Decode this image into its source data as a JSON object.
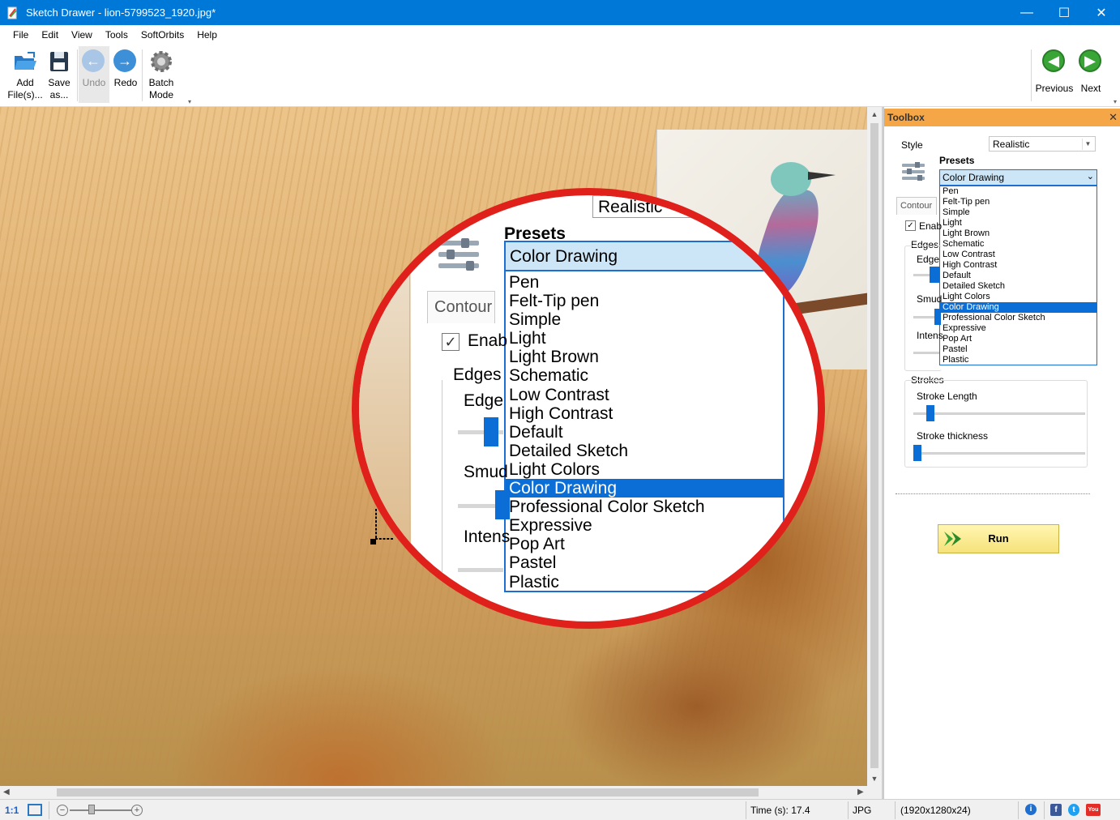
{
  "window": {
    "title": "Sketch Drawer - lion-5799523_1920.jpg*",
    "minimize": "—",
    "maximize": "☐",
    "close": "✕"
  },
  "menu": [
    "File",
    "Edit",
    "View",
    "Tools",
    "SoftOrbits",
    "Help"
  ],
  "toolbar": {
    "add_files": "Add\nFile(s)...",
    "save_as": "Save\nas...",
    "undo": "Undo",
    "redo": "Redo",
    "batch_mode": "Batch\nMode",
    "previous": "Previous",
    "next": "Next"
  },
  "toolbox": {
    "title": "Toolbox",
    "close": "✕",
    "style_label": "Style",
    "style_value": "Realistic",
    "presets_label": "Presets",
    "presets_value": "Color Drawing",
    "presets_options": [
      "Pen",
      "Felt-Tip pen",
      "Simple",
      "Light",
      "Light Brown",
      "Schematic",
      "Low Contrast",
      "High Contrast",
      "Default",
      "Detailed Sketch",
      "Light Colors",
      "Color Drawing",
      "Professional Color Sketch",
      "Expressive",
      "Pop Art",
      "Pastel",
      "Plastic"
    ],
    "presets_selected_index": 11,
    "contour_tab": "Contour",
    "enable_label": "Enab",
    "edges_label": "Edges",
    "edge_label": "Edge",
    "smudge_label": "Smud",
    "intensity_label": "Intens",
    "strokes_label": "Strokes",
    "stroke_length_label": "Stroke Length",
    "stroke_thickness_label": "Stroke thickness",
    "run_label": "Run"
  },
  "magnifier": {
    "style_value": "Realistic",
    "presets_label": "Presets",
    "presets_value": "Color Drawing",
    "contour_tab": "Contour",
    "enable_label": "Enab",
    "edges_label": "Edges",
    "edge_label": "Edge",
    "smudge_label": "Smud",
    "intensity_label": "Intens"
  },
  "status": {
    "zoom_ratio": "1:1",
    "zoom_minus": "−",
    "zoom_plus": "+",
    "time": "Time (s): 17.4",
    "format": "JPG",
    "dimensions": "(1920x1280x24)",
    "info": "i",
    "facebook": "f",
    "twitter": "t",
    "youtube": "You"
  },
  "colors": {
    "titlebar": "#0078d7",
    "toolbox_header": "#f5a748",
    "selection": "#0a6ed6",
    "magnifier_ring": "#e0201b",
    "nav_green": "#3aa537"
  },
  "icons": {
    "add_files": "folder-open-icon",
    "save_as": "floppy-disk-icon",
    "undo": "arrow-left-icon",
    "redo": "arrow-right-icon",
    "batch_mode": "gear-icon",
    "previous": "green-arrow-left-icon",
    "next": "green-arrow-right-icon"
  }
}
